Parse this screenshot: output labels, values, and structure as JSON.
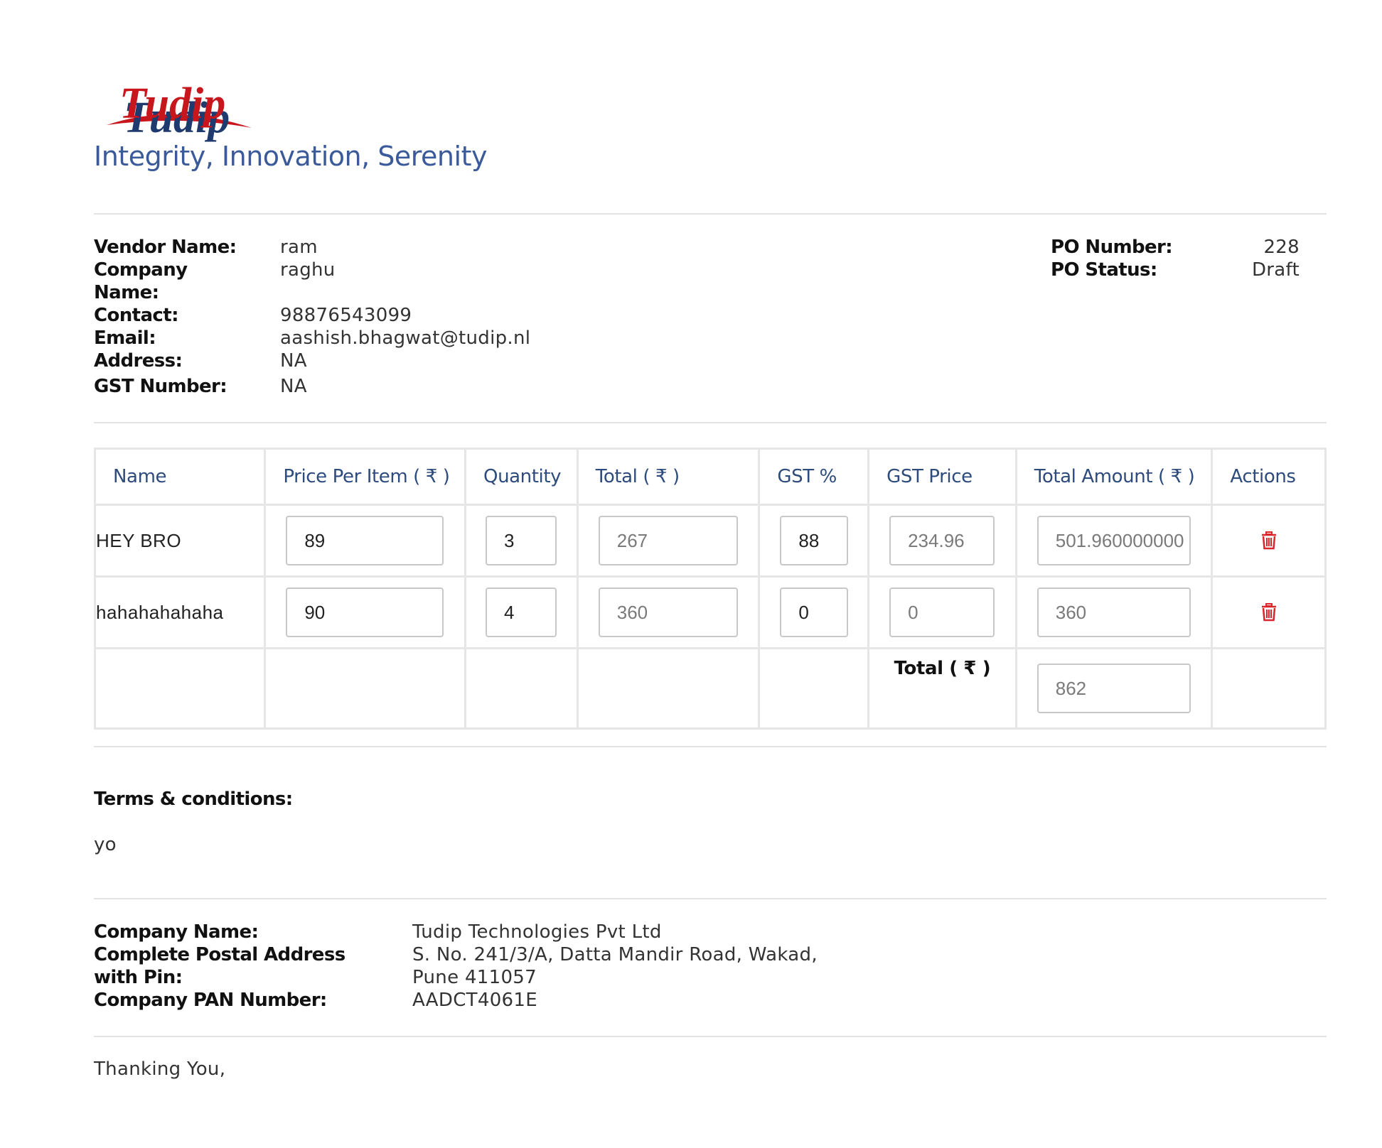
{
  "header": {
    "logo_text": "Tudip",
    "tagline": "Integrity, Innovation, Serenity"
  },
  "vendor": {
    "name_label": "Vendor Name:",
    "name_value": "ram",
    "company_label": "Company Name:",
    "company_value": "raghu",
    "contact_label": "Contact:",
    "contact_value": "98876543099",
    "email_label": "Email:",
    "email_value": "aashish.bhagwat@tudip.nl",
    "address_label": "Address:",
    "address_value": "NA",
    "gst_label": "GST Number:",
    "gst_value": "NA"
  },
  "po": {
    "number_label": "PO Number:",
    "number_value": "228",
    "status_label": "PO Status:",
    "status_value": "Draft"
  },
  "table": {
    "headers": [
      "Name",
      "Price Per Item ( ₹ )",
      "Quantity",
      "Total ( ₹ )",
      "GST %",
      "GST Price",
      "Total Amount ( ₹ )",
      "Actions"
    ],
    "rows": [
      {
        "name": "HEY BRO",
        "price": "89",
        "quantity": "3",
        "total": "267",
        "gst_percent": "88",
        "gst_price": "234.96",
        "total_amount": "501.960000000"
      },
      {
        "name": "hahahahahaha",
        "price": "90",
        "quantity": "4",
        "total": "360",
        "gst_percent": "0",
        "gst_price": "0",
        "total_amount": "360"
      }
    ],
    "footer_label": "Total ( ₹ )",
    "footer_total": "862",
    "delete_icon": "trash-icon",
    "delete_color": "#d9262c"
  },
  "terms": {
    "heading": "Terms & conditions:",
    "text": "yo"
  },
  "company": {
    "name_label": "Company Name:",
    "name_value": "Tudip Technologies Pvt Ltd",
    "address_label": "Complete Postal Address with Pin:",
    "address_value": "S. No. 241/3/A, Datta Mandir Road, Wakad, Pune 411057",
    "pan_label": "Company PAN Number:",
    "pan_value": "AADCT4061E"
  },
  "footer": {
    "thanks": "Thanking You,"
  },
  "colors": {
    "brand_red": "#c8161d",
    "brand_navy": "#1f3a6e",
    "tagline": "#3b5a99",
    "header_text": "#2d4b7d"
  }
}
